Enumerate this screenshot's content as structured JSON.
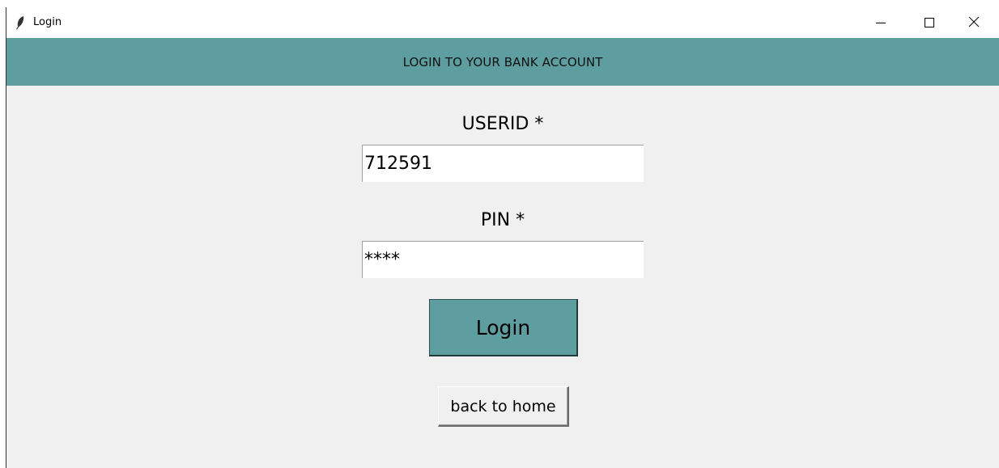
{
  "window": {
    "title": "Login",
    "controls": {
      "minimize": "minimize-icon",
      "maximize": "maximize-icon",
      "close": "close-icon"
    }
  },
  "header": {
    "text": "LOGIN TO YOUR BANK ACCOUNT",
    "color": "#5f9ea0"
  },
  "form": {
    "userid_label": "USERID *",
    "userid_value": "712591",
    "pin_label": "PIN *",
    "pin_value": "****"
  },
  "buttons": {
    "login_label": "Login",
    "back_label": "back to home"
  },
  "icons": {
    "app": "feather-icon"
  }
}
